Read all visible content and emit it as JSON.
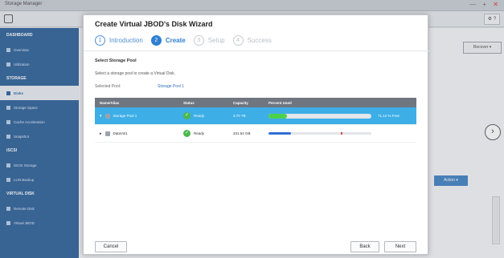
{
  "app": {
    "title": "Storage Manager",
    "toolbar_btn": "⚙ ?",
    "recover_label": "Recover ▾",
    "bg_action_label": "Action ▾"
  },
  "sidebar": {
    "items": [
      {
        "label": "DASHBOARD",
        "type": "section"
      },
      {
        "label": "Overview",
        "type": "item"
      },
      {
        "label": "Utilization",
        "type": "item"
      },
      {
        "label": "STORAGE",
        "type": "section"
      },
      {
        "label": "Disks",
        "type": "active"
      },
      {
        "label": "Storage Space",
        "type": "item"
      },
      {
        "label": "Cache Acceleration",
        "type": "item"
      },
      {
        "label": "Snapshot",
        "type": "item"
      },
      {
        "label": "iSCSI",
        "type": "section"
      },
      {
        "label": "iSCSI Storage",
        "type": "item"
      },
      {
        "label": "LUN Backup",
        "type": "item"
      },
      {
        "label": "VIRTUAL DISK",
        "type": "section"
      },
      {
        "label": "Remote Disk",
        "type": "item"
      },
      {
        "label": "Virtual JBOD",
        "type": "item"
      }
    ]
  },
  "dialog": {
    "title": "Create Virtual JBOD's Disk Wizard",
    "steps": [
      {
        "num": "1",
        "label": "Introduction",
        "state": "done"
      },
      {
        "num": "2",
        "label": "Create",
        "state": "current"
      },
      {
        "num": "3",
        "label": "Setup",
        "state": "pending"
      },
      {
        "num": "4",
        "label": "Success",
        "state": "pending"
      }
    ],
    "section_title": "Select Storage Pool",
    "description": "Select a storage pool to create a Virtual Disk.",
    "selected_label": "Selected Pool:",
    "selected_value": "Storage Pool 1",
    "table": {
      "headers": [
        "Name/Alias",
        "Status",
        "Capacity",
        "Percent Used"
      ],
      "rows": [
        {
          "name": "Storage Pool 1",
          "status": "Ready",
          "capacity": "3.70 TB",
          "percent": 0.18,
          "percent_text": "71.12 % Free",
          "selected": true,
          "expand": "▾"
        },
        {
          "name": "DataVol1",
          "status": "Ready",
          "capacity": "331.54 GB",
          "percent": 0.22,
          "percent_text": "",
          "selected": false,
          "expand": "▸"
        }
      ]
    },
    "buttons": {
      "cancel": "Cancel",
      "back": "Back",
      "next": "Next"
    }
  },
  "colors": {
    "accent": "#2f7fd0",
    "sidebar": "#2a5f96",
    "selected_row": "#3daee6",
    "ok": "#4cb84c",
    "bar_green": "#4cd14c",
    "bar_blue": "#2f6fd0"
  }
}
